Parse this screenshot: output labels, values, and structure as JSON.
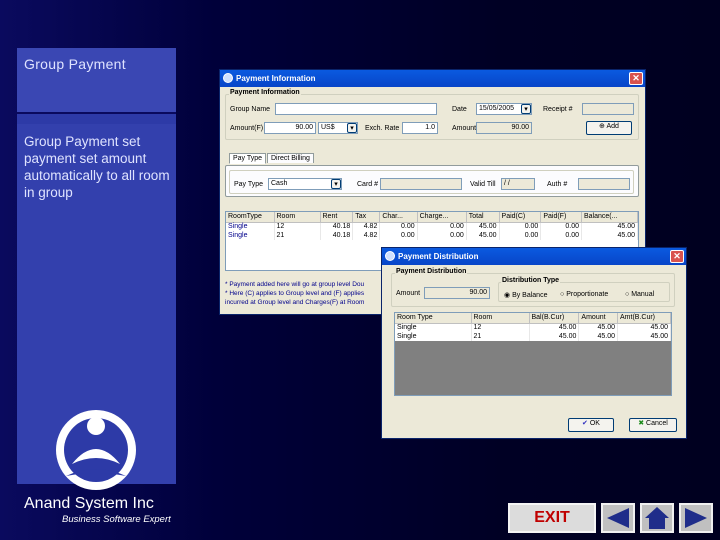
{
  "sidebar": {
    "title": "Group Payment",
    "description": "Group Payment set payment set amount automatically  to all room in group",
    "company": "Anand System Inc",
    "tagline": "Business Software Expert"
  },
  "payment_window": {
    "title": "Payment Information",
    "section": "Payment Information",
    "group_name_label": "Group Name",
    "group_name_value": "",
    "date_label": "Date",
    "date_value": "15/05/2005",
    "receipt_label": "Receipt #",
    "receipt_value": "",
    "amount_label": "Amount(F)",
    "amount_value": "90.00",
    "currency_value": "US$",
    "exch_rate_label": "Exch. Rate",
    "exch_rate_value": "1.0",
    "amount2_label": "Amount",
    "amount2_value": "90.00",
    "add_label": "Add",
    "tabs": [
      "Pay Type",
      "Direct Billing"
    ],
    "pay_type_label": "Pay Type",
    "pay_type_value": "Cash",
    "card_label": "Card #",
    "card_value": "",
    "valid_till_label": "Valid Till",
    "valid_till_value": "/ /",
    "auth_label": "Auth #",
    "auth_value": "",
    "grid_headers": [
      "RoomType",
      "Room",
      "Rent",
      "Tax",
      "Char...",
      "Charge...",
      "Total",
      "Paid(C)",
      "Paid(F)",
      "Balance(..."
    ],
    "grid_rows": [
      [
        "Single",
        "12",
        "40.18",
        "4.82",
        "0.00",
        "0.00",
        "45.00",
        "0.00",
        "0.00",
        "45.00"
      ],
      [
        "Single",
        "21",
        "40.18",
        "4.82",
        "0.00",
        "0.00",
        "45.00",
        "0.00",
        "0.00",
        "45.00"
      ]
    ],
    "notes": [
      "* Payment added here will go at group level Dou",
      "* Here (C) applies to Group level and (F) applies",
      "  incurred at Group level and Charges(F) at Room"
    ]
  },
  "distribution_window": {
    "title": "Payment Distribution",
    "section": "Payment Distribution",
    "amount_label": "Amount",
    "amount_value": "90.00",
    "dist_type_label": "Distribution Type",
    "options": [
      "By Balance",
      "Proportionate",
      "Manual"
    ],
    "selected_option": "By Balance",
    "grid_headers": [
      "Room Type",
      "Room",
      "Bal(B.Cur)",
      "Amount",
      "Amt(B.Cur)"
    ],
    "grid_rows": [
      [
        "Single",
        "12",
        "45.00",
        "45.00",
        "45.00"
      ],
      [
        "Single",
        "21",
        "45.00",
        "45.00",
        "45.00"
      ]
    ],
    "ok_label": "OK",
    "cancel_label": "Cancel"
  },
  "nav": {
    "exit_label": "EXIT"
  },
  "colors": {
    "background": "#000024",
    "sidebar": "#3340ad",
    "titlebar": "#0a5ae0",
    "exit_text": "#c00000"
  }
}
